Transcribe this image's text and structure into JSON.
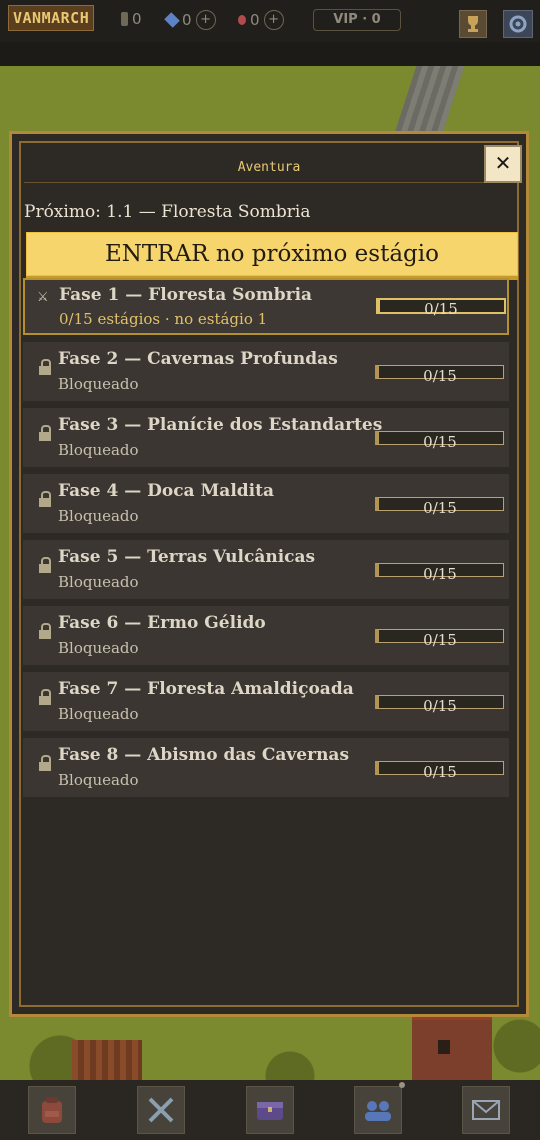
{
  "hud": {
    "logo": "VANMARCH",
    "coins": "0",
    "gems": "0",
    "potions": "0",
    "plus": "+",
    "vip": "VIP · 0"
  },
  "modal": {
    "title": "Aventura",
    "close": "✕",
    "next_label": "Próximo: 1.1 — Floresta Sombria",
    "enter_button": "ENTRAR no próximo estágio"
  },
  "stages": [
    {
      "name": "Fase 1 — Floresta Sombria",
      "status": "0/15 estágios · no estágio 1",
      "progress": "0/15",
      "fraction": 0,
      "locked": false,
      "icon": "crossed-swords-icon"
    },
    {
      "name": "Fase 2 — Cavernas Profundas",
      "status": "Bloqueado",
      "progress": "0/15",
      "fraction": 0,
      "locked": true,
      "icon": "lock-icon"
    },
    {
      "name": "Fase 3 — Planície dos Estandartes",
      "status": "Bloqueado",
      "progress": "0/15",
      "fraction": 0,
      "locked": true,
      "icon": "lock-icon"
    },
    {
      "name": "Fase 4 — Doca Maldita",
      "status": "Bloqueado",
      "progress": "0/15",
      "fraction": 0,
      "locked": true,
      "icon": "lock-icon"
    },
    {
      "name": "Fase 5 — Terras Vulcânicas",
      "status": "Bloqueado",
      "progress": "0/15",
      "fraction": 0,
      "locked": true,
      "icon": "lock-icon"
    },
    {
      "name": "Fase 6 — Ermo Gélido",
      "status": "Bloqueado",
      "progress": "0/15",
      "fraction": 0,
      "locked": true,
      "icon": "lock-icon"
    },
    {
      "name": "Fase 7 — Floresta Amaldiçoada",
      "status": "Bloqueado",
      "progress": "0/15",
      "fraction": 0,
      "locked": true,
      "icon": "lock-icon"
    },
    {
      "name": "Fase 8 — Abismo das Cavernas",
      "status": "Bloqueado",
      "progress": "0/15",
      "fraction": 0,
      "locked": true,
      "icon": "lock-icon"
    }
  ],
  "bottom_nav": [
    "backpack-icon",
    "crossed-swords-icon",
    "chest-icon",
    "party-icon",
    "mail-icon"
  ],
  "colors": {
    "accent": "#f7d56d",
    "frame": "#b48a3a",
    "panel": "#2d2a26"
  }
}
